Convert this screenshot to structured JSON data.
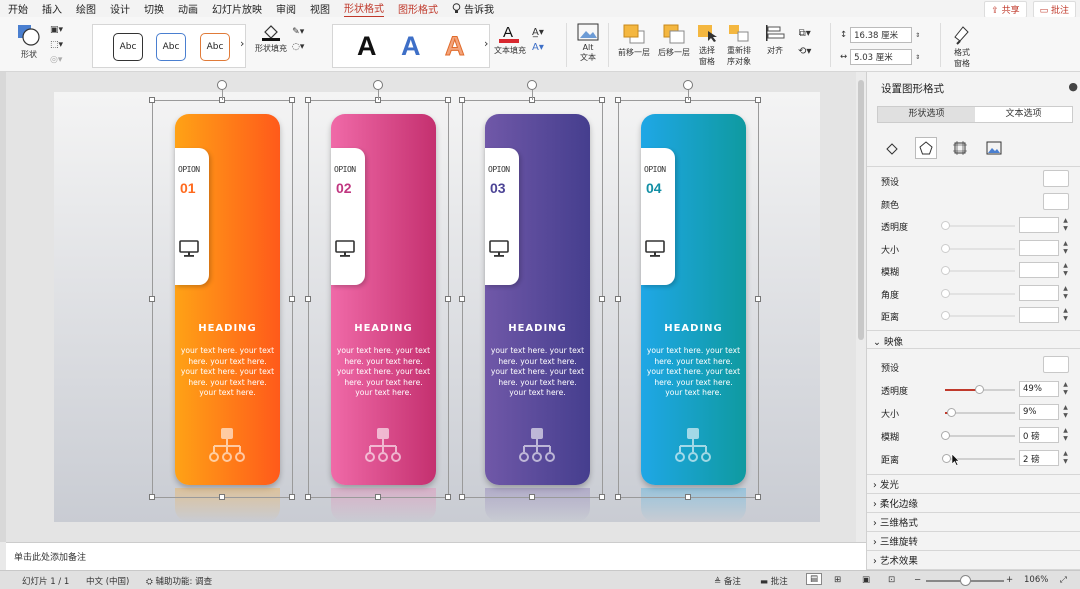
{
  "menu": {
    "items": [
      "开始",
      "插入",
      "绘图",
      "设计",
      "切换",
      "动画",
      "幻灯片放映",
      "审阅",
      "视图",
      "形状格式",
      "图形格式"
    ],
    "active_index": 9,
    "tell_me": "告诉我",
    "share": "共享",
    "comments": "批注"
  },
  "ribbon": {
    "shape_label": "形状",
    "style_samples": [
      "Abc",
      "Abc",
      "Abc"
    ],
    "shape_fill": "形状填充",
    "wordart_letters": [
      "A",
      "A",
      "A"
    ],
    "text_fill": "文本填充",
    "alt_text_line1": "Alt",
    "alt_text_line2": "文本",
    "bring_forward": "前移一层",
    "send_backward": "后移一层",
    "selection_pane_line1": "选择",
    "selection_pane_line2": "窗格",
    "reorder_line1": "重新排",
    "reorder_line2": "序对象",
    "align": "对齐",
    "height": "16.38 厘米",
    "width": "5.03 厘米",
    "format_pane_line1": "格式",
    "format_pane_line2": "窗格"
  },
  "slide": {
    "cards": [
      {
        "option": "OPION",
        "number": "01",
        "heading": "HEADING",
        "body": "your text here. your text here. your text here. your text here. your text here. your text here. your text here.",
        "c1": "#ffa216",
        "c2": "#ff5a1a",
        "num_color": "#ff6a1e"
      },
      {
        "option": "OPION",
        "number": "02",
        "heading": "HEADING",
        "body": "your text here. your text here. your text here. your text here. your text here. your text here. your text here.",
        "c1": "#f06aa8",
        "c2": "#c4306f",
        "num_color": "#c03680"
      },
      {
        "option": "OPION",
        "number": "03",
        "heading": "HEADING",
        "body": "your text here. your text here. your text here. your text here. your text here. your text here. your text here.",
        "c1": "#7058a8",
        "c2": "#453e8e",
        "num_color": "#4d4596"
      },
      {
        "option": "OPION",
        "number": "04",
        "heading": "HEADING",
        "body": "your text here. your text here. your text here. your text here. your text here. your text here. your text here.",
        "c1": "#1fa7e6",
        "c2": "#0f9aa0",
        "num_color": "#128fa5"
      }
    ]
  },
  "notes_placeholder": "单击此处添加备注",
  "pane": {
    "title": "设置图形格式",
    "tab_shape": "形状选项",
    "tab_text": "文本选项",
    "shadow_rows": [
      "预设",
      "颜色",
      "透明度",
      "大小",
      "模糊",
      "角度",
      "距离"
    ],
    "reflection_title": "映像",
    "reflection": {
      "preset": "预设",
      "transparency_label": "透明度",
      "transparency_value": "49%",
      "transparency_level": 0.49,
      "size_label": "大小",
      "size_value": "9%",
      "size_level": 0.09,
      "blur_label": "模糊",
      "blur_value": "0 磅",
      "blur_level": 0,
      "distance_label": "距离",
      "distance_value": "2 磅",
      "distance_level": 0.02
    },
    "sections": [
      "发光",
      "柔化边缘",
      "三维格式",
      "三维旋转",
      "艺术效果"
    ]
  },
  "status": {
    "slide_num": "幻灯片 1 / 1",
    "language": "中文 (中国)",
    "accessibility": "辅助功能: 调查",
    "notes": "备注",
    "comments": "批注",
    "zoom": "106%"
  }
}
